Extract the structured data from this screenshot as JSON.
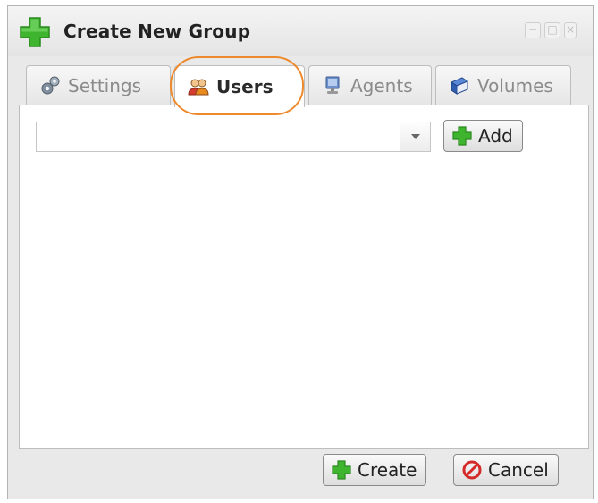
{
  "window": {
    "title": "Create New Group",
    "controls": [
      "minimize",
      "maximize",
      "close"
    ]
  },
  "tabs": [
    {
      "label": "Settings",
      "icon": "gears-icon",
      "active": false
    },
    {
      "label": "Users",
      "icon": "users-icon",
      "active": true
    },
    {
      "label": "Agents",
      "icon": "computer-icon",
      "active": false
    },
    {
      "label": "Volumes",
      "icon": "book-icon",
      "active": false
    }
  ],
  "users_panel": {
    "combo_value": "",
    "add_label": "Add"
  },
  "footer": {
    "create_label": "Create",
    "cancel_label": "Cancel"
  },
  "colors": {
    "highlight": "#ee8a2c",
    "plus_green": "#3fb52f",
    "cancel_red": "#d62a2a"
  }
}
